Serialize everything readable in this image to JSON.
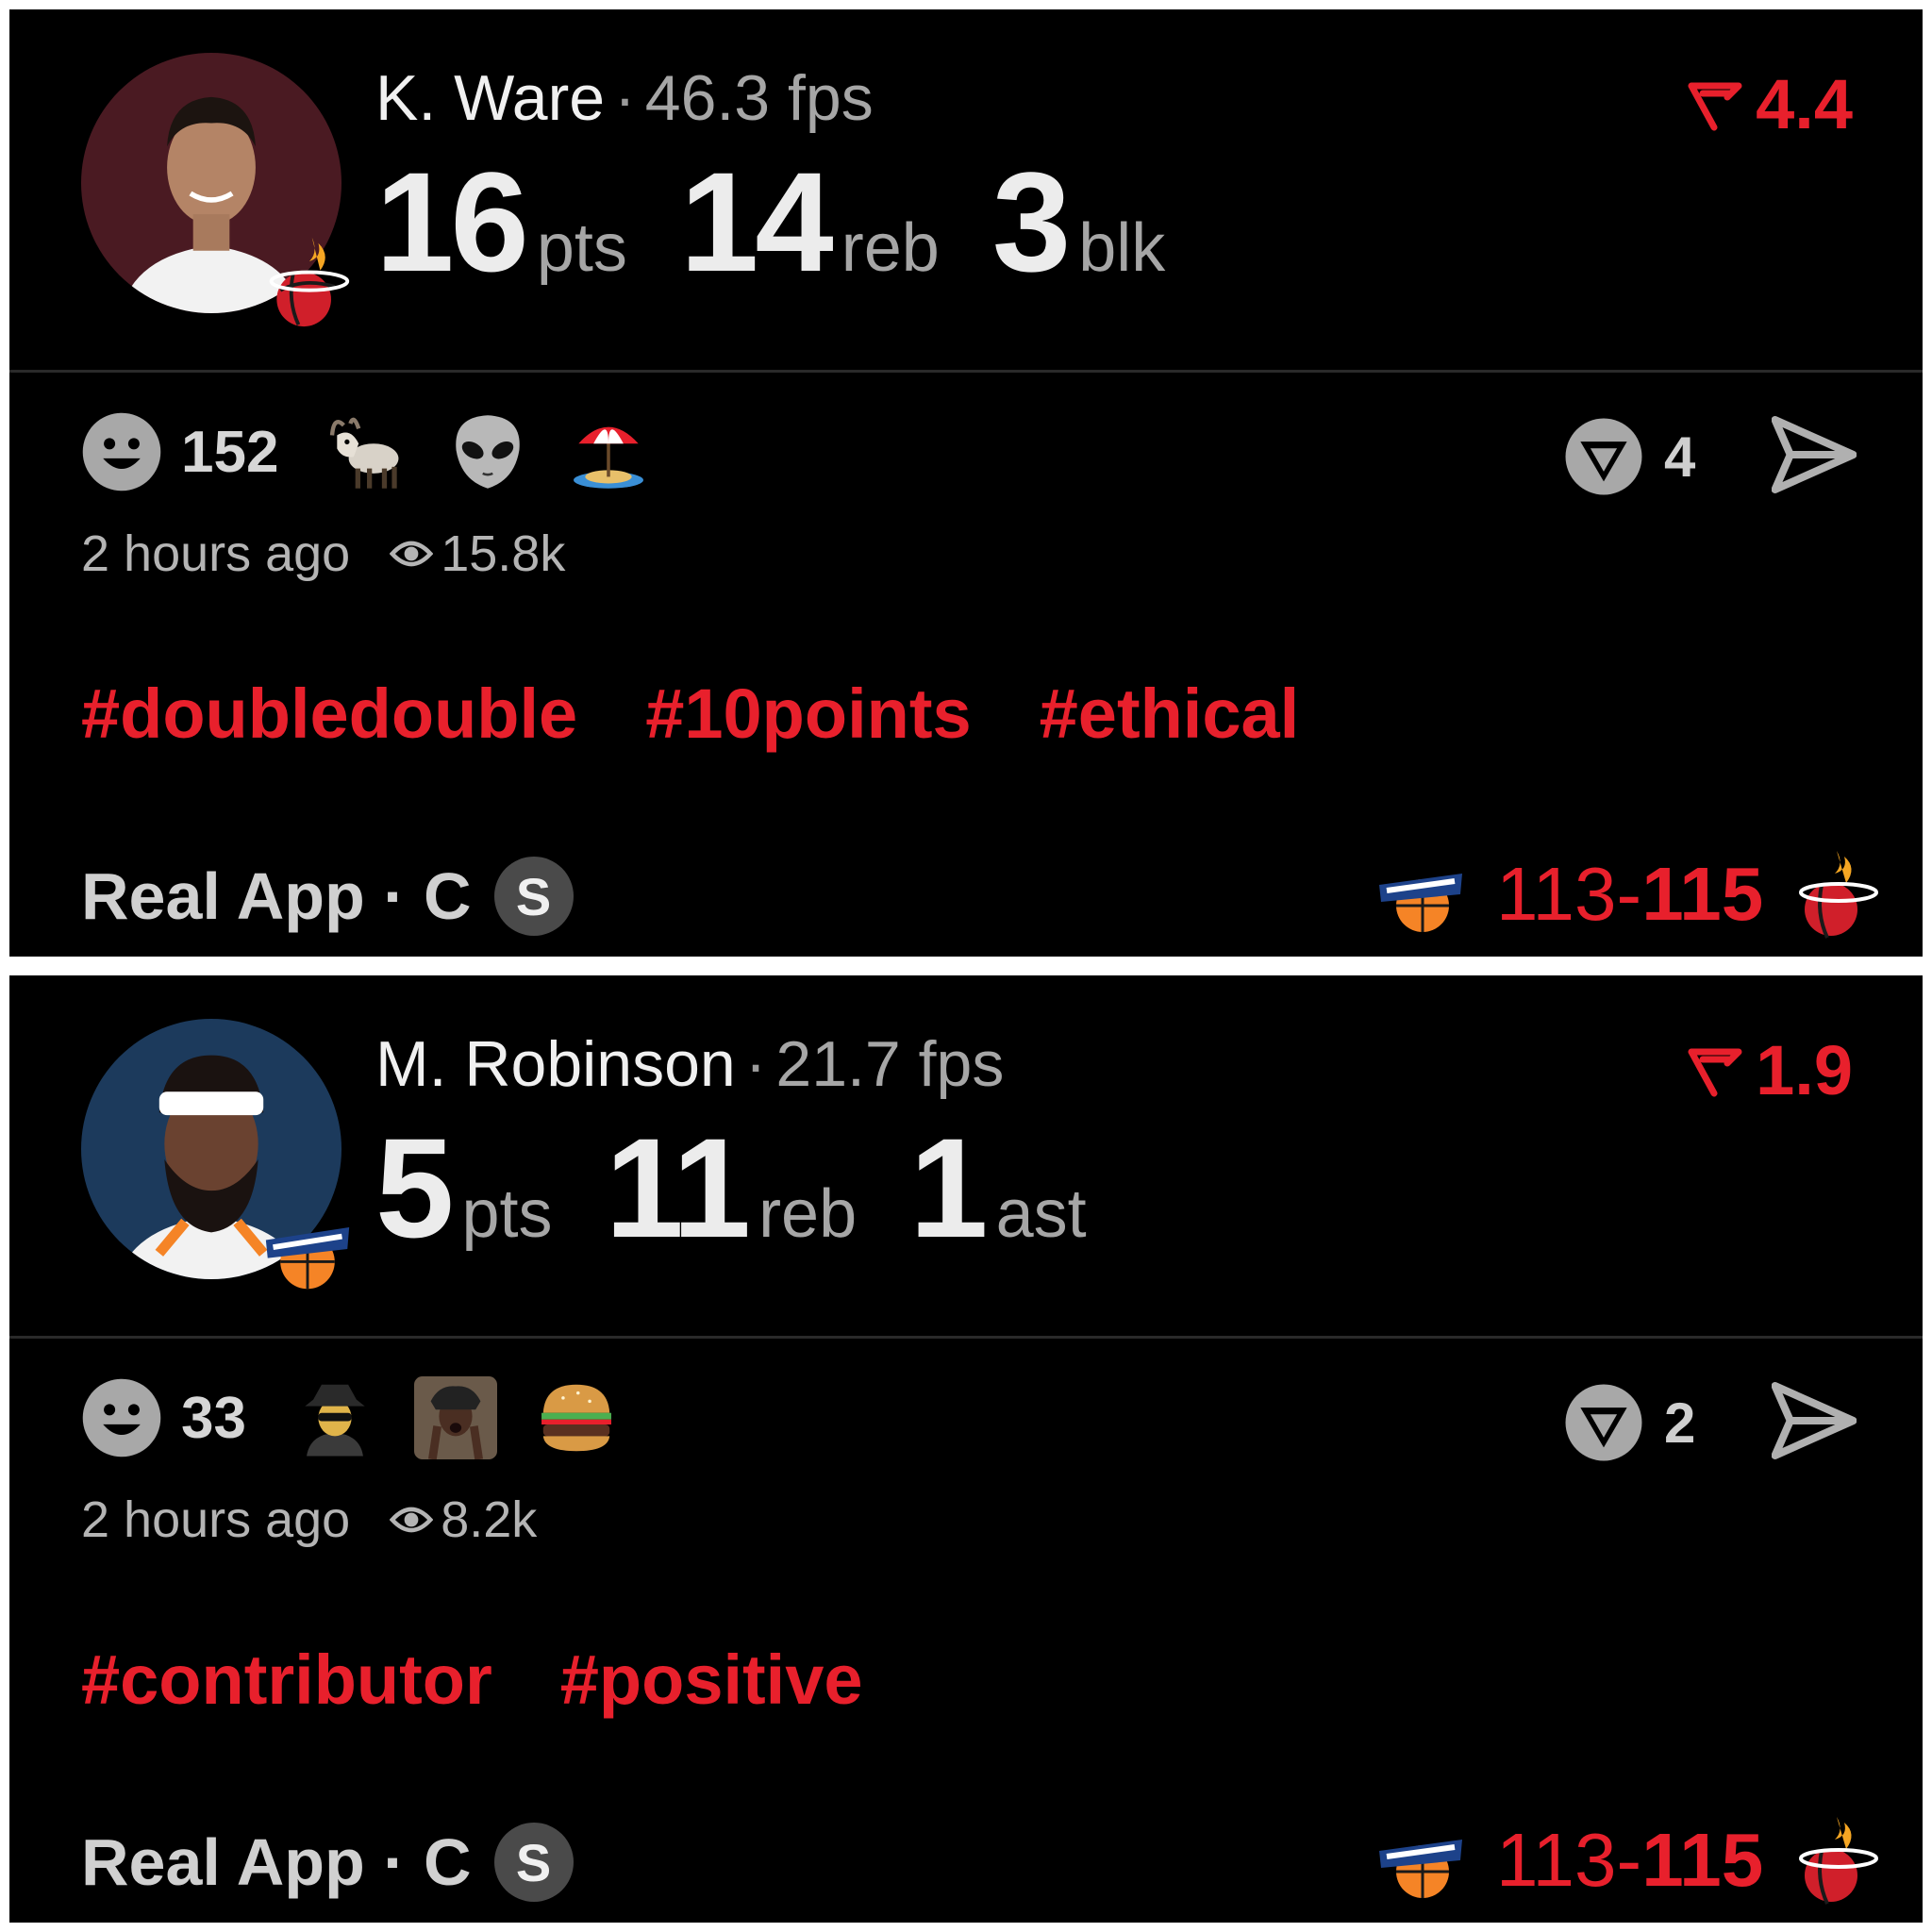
{
  "cards": [
    {
      "player": "K. Ware",
      "fps": "46.3 fps",
      "stats": [
        {
          "value": "16",
          "unit": "pts"
        },
        {
          "value": "14",
          "unit": "reb"
        },
        {
          "value": "3",
          "unit": "blk"
        }
      ],
      "rating": "4.4",
      "reaction_count": "152",
      "reaction_emojis": [
        "goat-icon",
        "alien-icon",
        "beach-umbrella-icon"
      ],
      "ring_count": "4",
      "time_ago": "2 hours ago",
      "views": "15.8k",
      "tags": [
        "#doubledouble",
        "#10points",
        "#ethical"
      ],
      "source": "Real App · C",
      "source_badge": "S",
      "score_left": "113-",
      "score_right": "115",
      "team_logo": "heat-logo-icon"
    },
    {
      "player": "M. Robinson",
      "fps": "21.7 fps",
      "stats": [
        {
          "value": "5",
          "unit": "pts"
        },
        {
          "value": "11",
          "unit": "reb"
        },
        {
          "value": "1",
          "unit": "ast"
        }
      ],
      "rating": "1.9",
      "reaction_count": "33",
      "reaction_emojis": [
        "detective-icon",
        "person-reaction-icon",
        "hamburger-icon"
      ],
      "ring_count": "2",
      "time_ago": "2 hours ago",
      "views": "8.2k",
      "tags": [
        "#contributor",
        "#positive"
      ],
      "source": "Real App · C",
      "source_badge": "S",
      "score_left": "113-",
      "score_right": "115",
      "team_logo": "knicks-logo-icon"
    }
  ],
  "colors": {
    "accent": "#e8202c",
    "background": "#000000",
    "muted": "#a6a6a6"
  }
}
